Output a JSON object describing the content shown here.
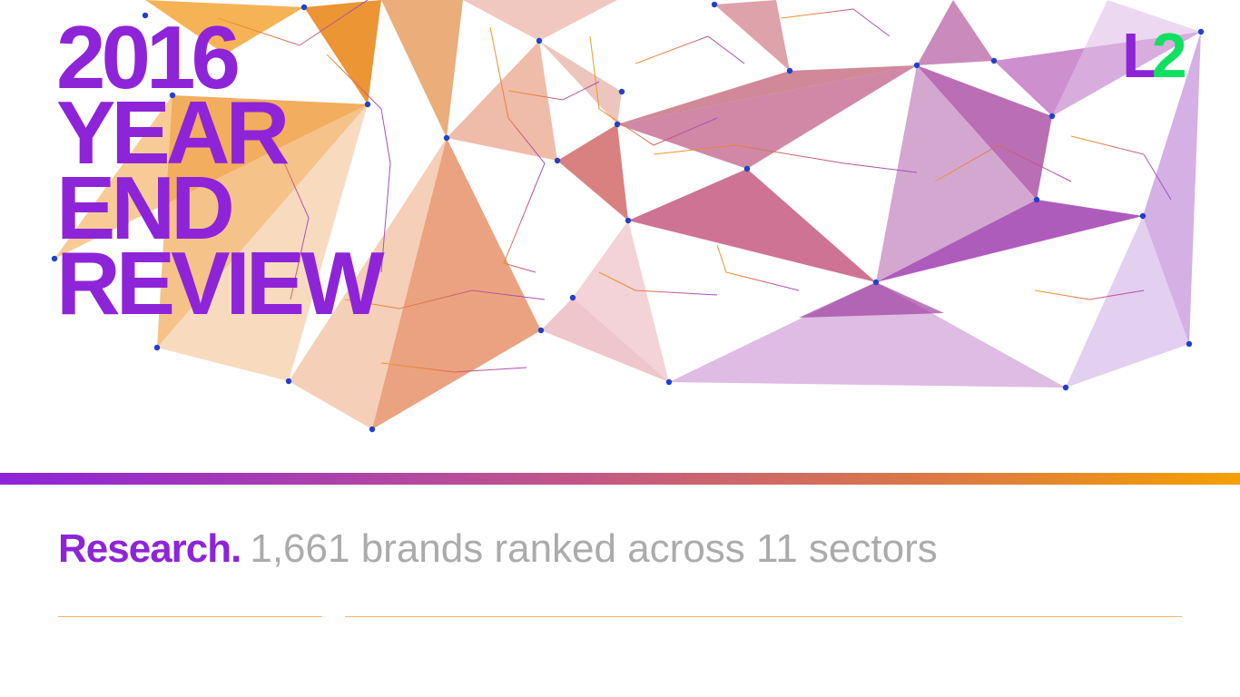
{
  "cover": {
    "title_lines": [
      "2016",
      "YEAR",
      "END",
      "REVIEW"
    ],
    "logo": {
      "letter": "L",
      "digit": "2"
    },
    "subtitle_strong": "Research.",
    "subtitle_text": "1,661 brands ranked across 11 sectors"
  },
  "colors": {
    "purple": "#8e24d8",
    "orange": "#f5a000",
    "logo_green": "#10e060",
    "node_blue": "#2240c8",
    "subtitle_gray": "#ababab"
  }
}
